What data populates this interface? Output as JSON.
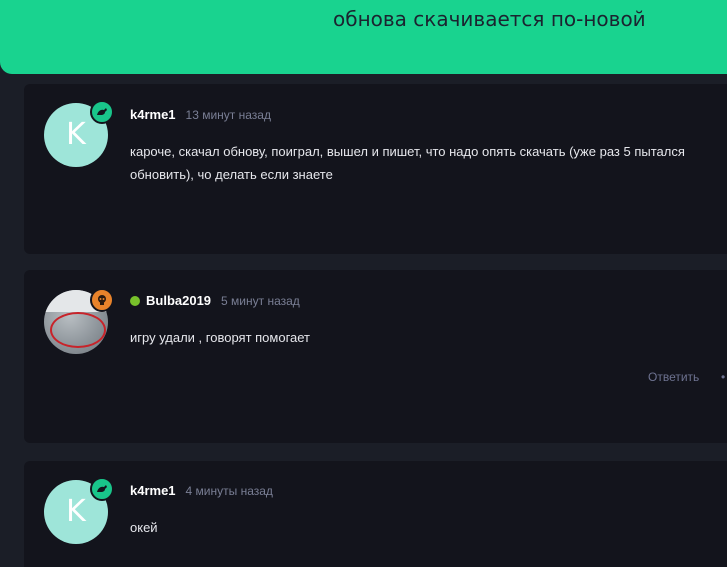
{
  "topic": {
    "title": "обнова скачивается по-новой"
  },
  "colors": {
    "banner": "#19d38f",
    "page_bg": "#1b1e27",
    "card_bg": "#13141c",
    "badge_green": "#19c58a",
    "badge_orange": "#e8832b",
    "online": "#78c12b"
  },
  "posts": [
    {
      "avatar_letter": "K",
      "author": "k4rme1",
      "time": "13 минут назад",
      "text": "кароче, скачал обнову, поиграл, вышел и пишет, что надо опять скачать (уже раз 5 пытался обновить), чо делать если знаете",
      "badge_icon": "rat-icon"
    },
    {
      "author": "Bulba2019",
      "time": "5 минут назад",
      "text": "игру удали , говорят помогает",
      "badge_icon": "skull-icon",
      "reply_label": "Ответить",
      "more": "•"
    },
    {
      "avatar_letter": "K",
      "author": "k4rme1",
      "time": "4 минуты назад",
      "text": "окей",
      "badge_icon": "rat-icon"
    }
  ]
}
